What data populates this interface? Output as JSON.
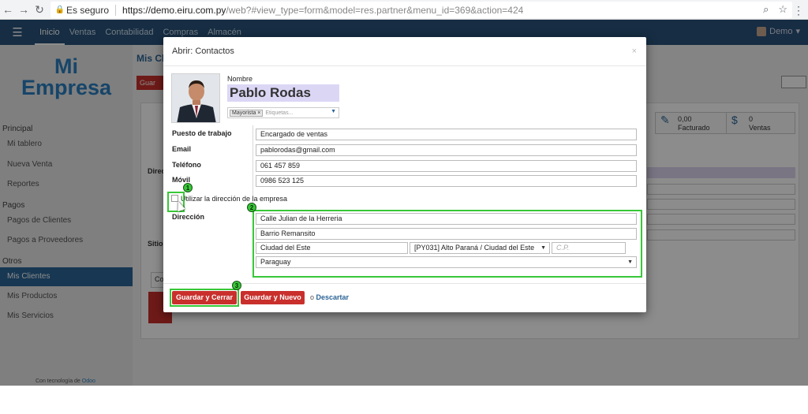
{
  "browser": {
    "secure_label": "Es seguro",
    "url_host": "https://demo.eiru.com.py",
    "url_path": "/web?#view_type=form&model=res.partner&menu_id=369&action=424"
  },
  "topbar": {
    "items": [
      "Inicio",
      "Ventas",
      "Contabilidad",
      "Compras",
      "Almacén"
    ],
    "user": "Demo"
  },
  "sidebar": {
    "logo_line1": "Mi",
    "logo_line2": "Empresa",
    "sections": [
      {
        "title": "Principal",
        "items": [
          "Mi tablero",
          "Nueva Venta",
          "Reportes"
        ]
      },
      {
        "title": "Pagos",
        "items": [
          "Pagos de Clientes",
          "Pagos a Proveedores"
        ]
      },
      {
        "title": "Otros",
        "items": [
          "Mis Clientes",
          "Mis Productos",
          "Mis Servicios"
        ]
      }
    ],
    "active_item": "Mis Clientes",
    "powered_prefix": "Con tecnología de",
    "powered_brand": "Odoo"
  },
  "background": {
    "title": "Mis Cl",
    "save_label": "Guar",
    "stat_facturado_value": "0,00",
    "stat_facturado_label": "Facturado",
    "stat_ventas_value": "0",
    "stat_ventas_label": "Ventas",
    "label_direccion": "Direc",
    "label_sitio": "Sitio",
    "tab_label": "Co"
  },
  "modal": {
    "title": "Abrir: Contactos",
    "close_label": "×",
    "name_label": "Nombre",
    "name_value": "Pablo Rodas",
    "tag": "Mayorista",
    "tag_remove": "×",
    "tags_placeholder": "Etiquetas...",
    "fields": [
      {
        "label": "Puesto de trabajo",
        "value": "Encargado de ventas"
      },
      {
        "label": "Email",
        "value": "pablorodas@gmail.com"
      },
      {
        "label": "Teléfono",
        "value": "061 457 859"
      },
      {
        "label": "Móvil",
        "value": "0986 523 125"
      }
    ],
    "use_company_address_label": "Utilizar la dirección de la empresa",
    "address_label": "Dirección",
    "address": {
      "street": "Calle Julian de la Herreria",
      "street2": "Barrio Remansito",
      "city": "Ciudad del Este",
      "state": "[PY031] Alto Paraná / Ciudad del Este",
      "zip_placeholder": "C.P.",
      "country": "Paraguay"
    },
    "btn_save_close": "Guardar y Cerrar",
    "btn_save_new": "Guardar y Nuevo",
    "or_label": "o",
    "discard_label": "Descartar"
  },
  "annotations": [
    "1",
    "2",
    "3"
  ],
  "colors": {
    "topbar": "#28527a",
    "primary_button": "#c9302c",
    "highlight": "#38c738",
    "name_bg": "#dcd6f5"
  }
}
